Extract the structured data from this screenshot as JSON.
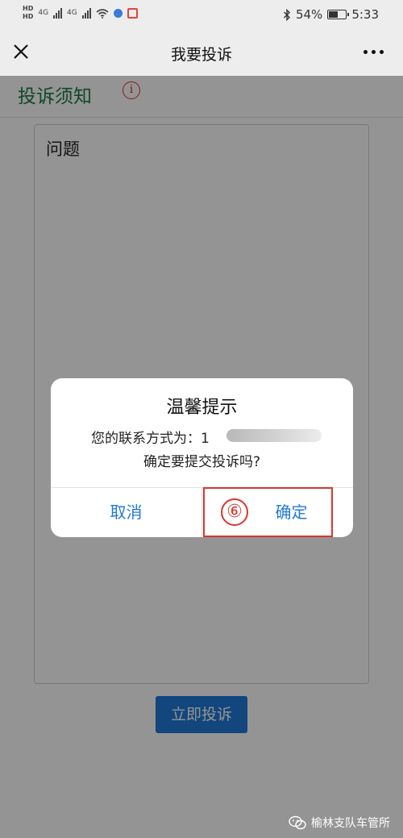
{
  "status_bar": {
    "hd_label": "HD",
    "network_1": "4G",
    "network_2": "4G",
    "bluetooth_icon": "bluetooth-icon",
    "battery_percent": "54%",
    "battery_level": 0.54,
    "time": "5:33"
  },
  "nav": {
    "title": "我要投诉",
    "close_icon": "close-icon",
    "more_icon": "more-icon"
  },
  "notice": {
    "text": "投诉须知",
    "icon": "info-icon"
  },
  "form": {
    "question_label": "问题",
    "submit_label": "立即投诉"
  },
  "dialog": {
    "title": "温馨提示",
    "contact_prefix": "您的联系方式为：1",
    "confirm_question": "确定要提交投诉吗?",
    "cancel_label": "取消",
    "confirm_label": "确定"
  },
  "annotation": {
    "step_marker": "⑥",
    "highlight_color": "#d9362e"
  },
  "watermark": {
    "text": "榆林支队车管所"
  },
  "colors": {
    "accent": "#2079d8",
    "notice_green": "#1a7a4c",
    "nav_bg": "#ededed"
  }
}
